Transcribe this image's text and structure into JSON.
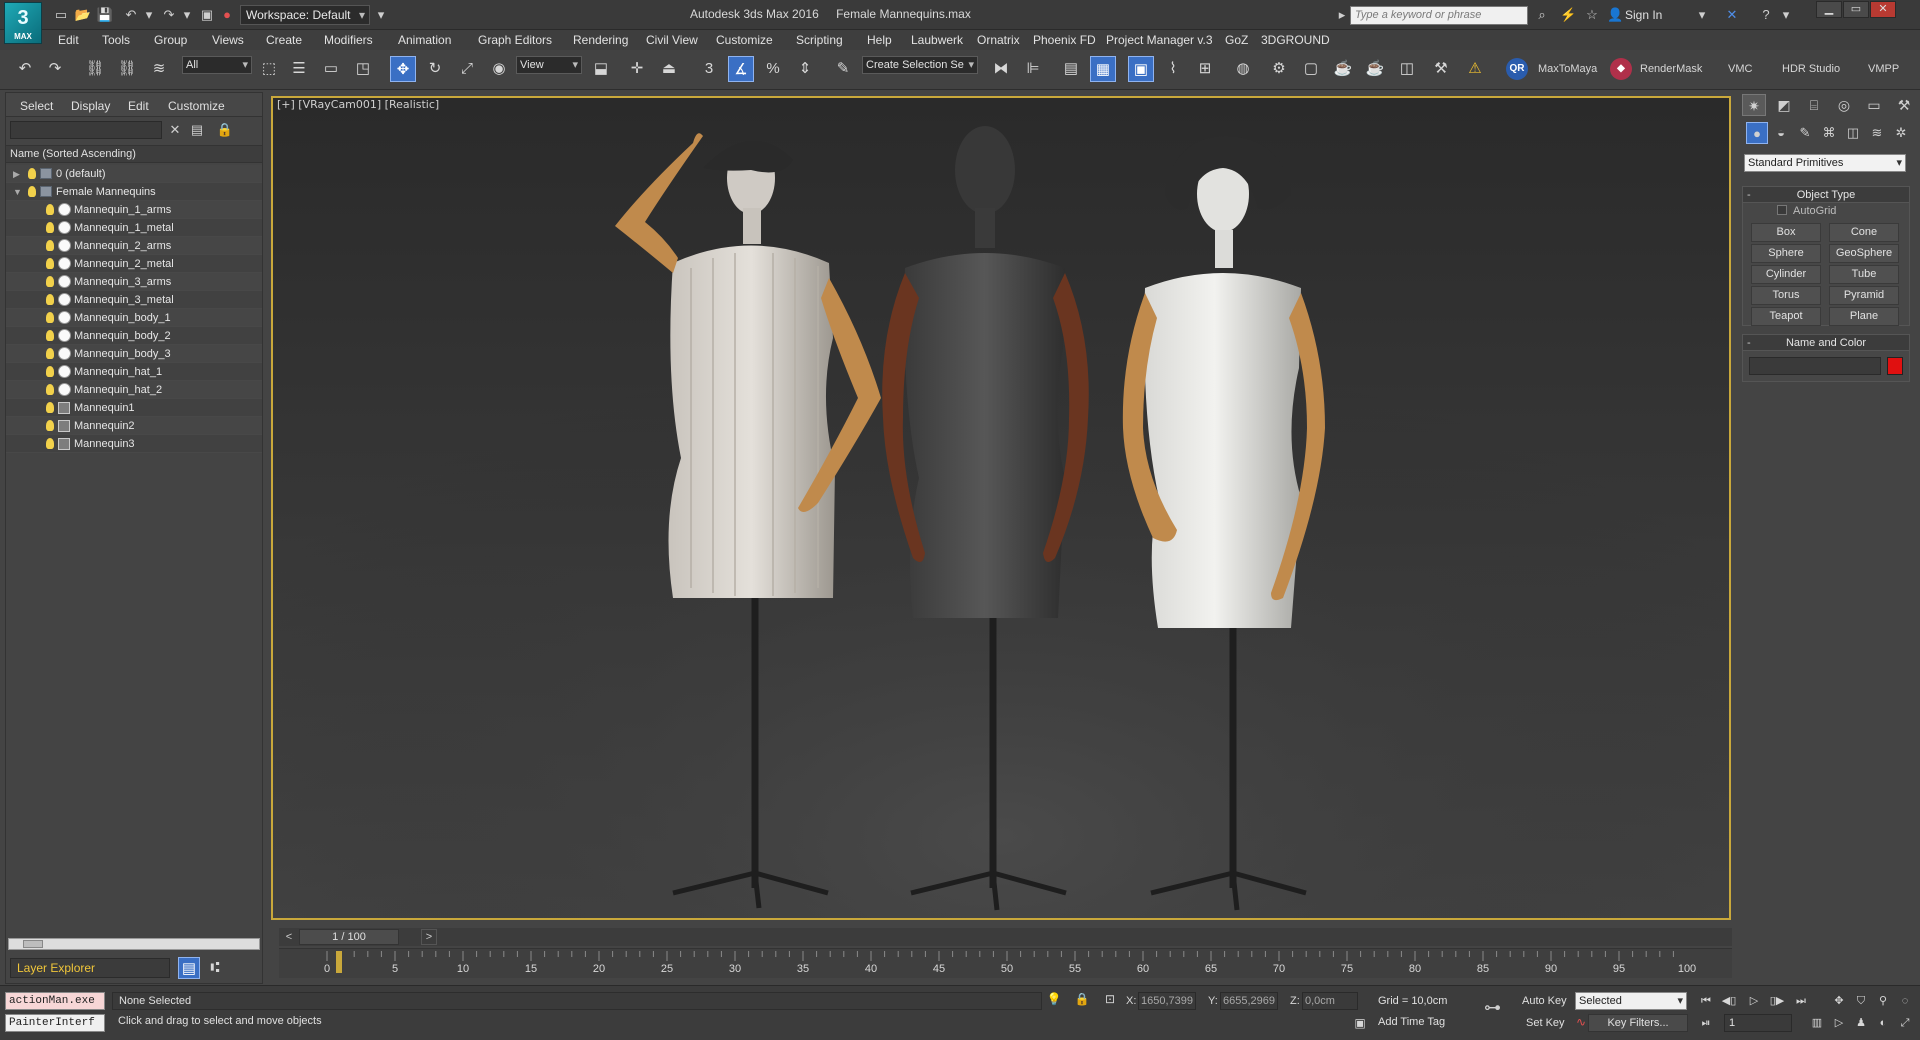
{
  "titlebar": {
    "logo": "3",
    "logo_sub": "MAX",
    "workspace": "Workspace: Default",
    "app_title": "Autodesk 3ds Max 2016",
    "file_title": "Female Mannequins.max",
    "search_placeholder": "Type a keyword or phrase",
    "sign_in": "Sign In",
    "min": "▁",
    "max": "▭",
    "close": "✕"
  },
  "menu": [
    "Edit",
    "Tools",
    "Group",
    "Views",
    "Create",
    "Modifiers",
    "Animation",
    "Graph Editors",
    "Rendering",
    "Civil View",
    "Customize",
    "Scripting",
    "Help",
    "Laubwerk",
    "Ornatrix",
    "Phoenix FD",
    "Project Manager v.3",
    "GoZ",
    "3DGROUND"
  ],
  "toolbar": {
    "selection_filter": "All",
    "reference_coord": "View",
    "named_selection": "Create Selection Se",
    "snap_label": "3",
    "plugins": [
      "MaxToMaya",
      "RenderMask",
      "VMC",
      "HDR Studio",
      "VMPP"
    ]
  },
  "explorer": {
    "tabs": [
      "Select",
      "Display",
      "Edit",
      "Customize"
    ],
    "sort_header": "Name (Sorted Ascending)",
    "layer_explorer": "Layer Explorer",
    "items": [
      {
        "label": "0 (default)",
        "kind": "layer",
        "level": 0,
        "expander": "▶"
      },
      {
        "label": "Female Mannequins",
        "kind": "layer",
        "level": 0,
        "expander": "▼"
      },
      {
        "label": "Mannequin_1_arms",
        "kind": "object",
        "level": 1,
        "expander": ""
      },
      {
        "label": "Mannequin_1_metal",
        "kind": "object",
        "level": 1,
        "expander": ""
      },
      {
        "label": "Mannequin_2_arms",
        "kind": "object",
        "level": 1,
        "expander": ""
      },
      {
        "label": "Mannequin_2_metal",
        "kind": "object",
        "level": 1,
        "expander": ""
      },
      {
        "label": "Mannequin_3_arms",
        "kind": "object",
        "level": 1,
        "expander": ""
      },
      {
        "label": "Mannequin_3_metal",
        "kind": "object",
        "level": 1,
        "expander": ""
      },
      {
        "label": "Mannequin_body_1",
        "kind": "object",
        "level": 1,
        "expander": ""
      },
      {
        "label": "Mannequin_body_2",
        "kind": "object",
        "level": 1,
        "expander": ""
      },
      {
        "label": "Mannequin_body_3",
        "kind": "object",
        "level": 1,
        "expander": ""
      },
      {
        "label": "Mannequin_hat_1",
        "kind": "object",
        "level": 1,
        "expander": ""
      },
      {
        "label": "Mannequin_hat_2",
        "kind": "object",
        "level": 1,
        "expander": ""
      },
      {
        "label": "Mannequin1",
        "kind": "group",
        "level": 1,
        "expander": ""
      },
      {
        "label": "Mannequin2",
        "kind": "group",
        "level": 1,
        "expander": ""
      },
      {
        "label": "Mannequin3",
        "kind": "group",
        "level": 1,
        "expander": ""
      }
    ]
  },
  "viewport": {
    "label": "[+] [VRayCam001] [Realistic]",
    "border_color": "#c9a83b"
  },
  "command_panel": {
    "category": "Standard Primitives",
    "object_type_title": "Object Type",
    "autogrid": "AutoGrid",
    "buttons": [
      "Box",
      "Cone",
      "Sphere",
      "GeoSphere",
      "Cylinder",
      "Tube",
      "Torus",
      "Pyramid",
      "Teapot",
      "Plane"
    ],
    "name_color_title": "Name and Color",
    "swatch_color": "#e01010",
    "collapse_glyph": "-"
  },
  "timeline": {
    "frame_indicator": "1 / 100",
    "prev": "<",
    "next": ">",
    "ticks": [
      "0",
      "5",
      "10",
      "15",
      "20",
      "25",
      "30",
      "35",
      "40",
      "45",
      "50",
      "55",
      "60",
      "65",
      "70",
      "75",
      "80",
      "85",
      "90",
      "95",
      "100"
    ]
  },
  "status": {
    "listener_1": "actionMan.exe",
    "listener_2": "PainterInterf",
    "selection": "None Selected",
    "prompt": "Click and drag to select and move objects",
    "x_label": "X:",
    "x_value": "1650,7399",
    "y_label": "Y:",
    "y_value": "6655,2969",
    "z_label": "Z:",
    "z_value": "0,0cm",
    "grid": "Grid = 10,0cm",
    "add_time_tag": "Add Time Tag",
    "auto_key": "Auto Key",
    "set_key": "Set Key",
    "selected": "Selected",
    "key_filters": "Key Filters...",
    "frame": "1"
  }
}
